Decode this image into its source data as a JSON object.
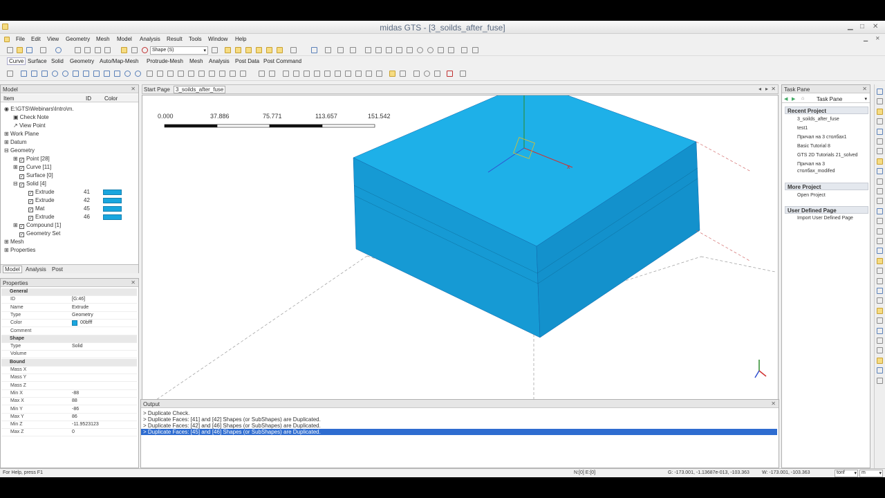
{
  "app": {
    "title": "midas GTS - [3_soilds_after_fuse]"
  },
  "menu": [
    "File",
    "Edit",
    "View",
    "Geometry",
    "Mesh",
    "Model",
    "Analysis",
    "Result",
    "Tools",
    "Window",
    "Help"
  ],
  "toolbar": {
    "shape_filter": "Shape (S)"
  },
  "ribbon_tabs": [
    "Curve",
    "Surface",
    "Solid",
    "Geometry",
    "Auto/Map-Mesh",
    "Protrude-Mesh",
    "Mesh",
    "Analysis",
    "Post Data",
    "Post Command"
  ],
  "model_panel": {
    "title": "Model",
    "columns": {
      "item": "Item",
      "id": "ID",
      "color": "Color"
    },
    "tree": [
      {
        "label": "E:\\GTS\\Webinars\\Intro\\m."
      },
      {
        "label": "Check Note"
      },
      {
        "label": "View Point"
      },
      {
        "label": "Work Plane"
      },
      {
        "label": "Datum"
      },
      {
        "label": "Geometry"
      },
      {
        "label": "Point [28]"
      },
      {
        "label": "Curve [11]"
      },
      {
        "label": "Surface [0]"
      },
      {
        "label": "Solid [4]"
      },
      {
        "label": "Extrude",
        "id": "41"
      },
      {
        "label": "Extrude",
        "id": "42"
      },
      {
        "label": "Mat",
        "id": "45"
      },
      {
        "label": "Extrude",
        "id": "46"
      },
      {
        "label": "Compound [1]"
      },
      {
        "label": "Geometry Set"
      },
      {
        "label": "Mesh"
      },
      {
        "label": "Properties"
      }
    ],
    "tabs": [
      "Model",
      "Analysis",
      "Post"
    ],
    "solid_color": "#1aa6de"
  },
  "properties": {
    "title": "Properties",
    "rows": [
      {
        "k": "General",
        "v": "",
        "group": true
      },
      {
        "k": "ID",
        "v": "[G:46]"
      },
      {
        "k": "Name",
        "v": "Extrude"
      },
      {
        "k": "Type",
        "v": "Geometry"
      },
      {
        "k": "Color",
        "v": "00bfff"
      },
      {
        "k": "Comment",
        "v": ""
      },
      {
        "k": "Shape",
        "v": "",
        "group": true
      },
      {
        "k": "Type",
        "v": "Solid"
      },
      {
        "k": "Volume",
        "v": ""
      },
      {
        "k": "Bound",
        "v": "",
        "group": true
      },
      {
        "k": "Mass X",
        "v": ""
      },
      {
        "k": "Mass Y",
        "v": ""
      },
      {
        "k": "Mass Z",
        "v": ""
      },
      {
        "k": "Min X",
        "v": "-88"
      },
      {
        "k": "Max X",
        "v": "88"
      },
      {
        "k": "Min Y",
        "v": "-86"
      },
      {
        "k": "Max Y",
        "v": "86"
      },
      {
        "k": "Min Z",
        "v": "-11.9523123"
      },
      {
        "k": "Max Z",
        "v": "0"
      }
    ]
  },
  "doc_tabs": [
    "Start Page",
    "3_soilds_after_fuse"
  ],
  "viewport": {
    "scale_labels": [
      "0.000",
      "37.886",
      "75.771",
      "113.657",
      "151.542"
    ],
    "solid_color": "#1aa6de"
  },
  "output": {
    "title": "Output",
    "lines": [
      "> Duplicate Check.",
      "> Duplicate Faces: [41] and [42] Shapes (or SubShapes) are Duplicated.",
      "> Duplicate Faces: [42] and [46] Shapes (or SubShapes) are Duplicated.",
      "> Duplicate Faces: [45] and [46] Shapes (or SubShapes) are Duplicated."
    ]
  },
  "task_pane": {
    "title": "Task Pane",
    "header": "Task Pane",
    "recent_title": "Recent Project",
    "recent": [
      "3_soilds_after_fuse",
      "test1",
      "Причал на 3 столбах1",
      "Basic Tutorial 8",
      "GTS 2D Tutorials 21_solved",
      "Причал на 3",
      "столбах_modifed"
    ],
    "more_title": "More Project",
    "more": [
      "Open Project"
    ],
    "user_title": "User Defined Page",
    "user": [
      "Import User Defined Page"
    ]
  },
  "status": {
    "help": "For Help, press F1",
    "counts": "N:[0] E:[0]",
    "coords_g": "G: -173.001, -1.13687e-013, -103.363",
    "coords_w": "W: -173.001, -103.363",
    "unit_force": "tonf",
    "unit_length": "m"
  }
}
